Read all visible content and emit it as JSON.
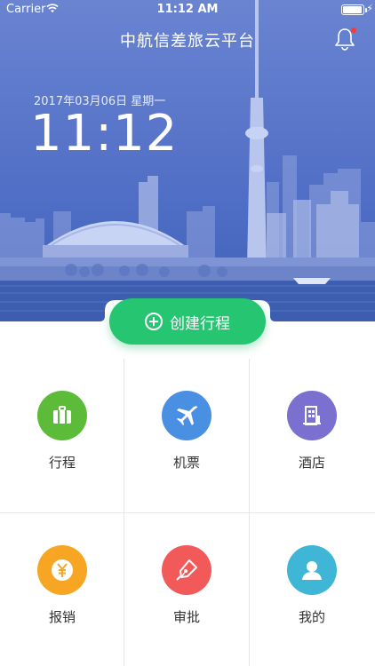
{
  "status_bar": {
    "carrier": "Carrier",
    "time": "11:12 AM",
    "battery_level": 0.95
  },
  "header": {
    "title": "中航信差旅云平台",
    "notification_icon": "bell-icon",
    "has_unread": true
  },
  "clock": {
    "date": "2017年03月06日  星期一",
    "time": "11:12"
  },
  "create_button": {
    "label": "创建行程",
    "icon": "plus-circle-icon",
    "color": "#25c572"
  },
  "menu": [
    {
      "label": "行程",
      "icon": "luggage-icon",
      "color": "#5dbb3a"
    },
    {
      "label": "机票",
      "icon": "airplane-icon",
      "color": "#4a90e2"
    },
    {
      "label": "酒店",
      "icon": "hotel-icon",
      "color": "#7b6fd0"
    },
    {
      "label": "报销",
      "icon": "yen-icon",
      "color": "#f6a623"
    },
    {
      "label": "审批",
      "icon": "pen-icon",
      "color": "#f25a5a"
    },
    {
      "label": "我的",
      "icon": "user-icon",
      "color": "#3fb6d6"
    }
  ]
}
